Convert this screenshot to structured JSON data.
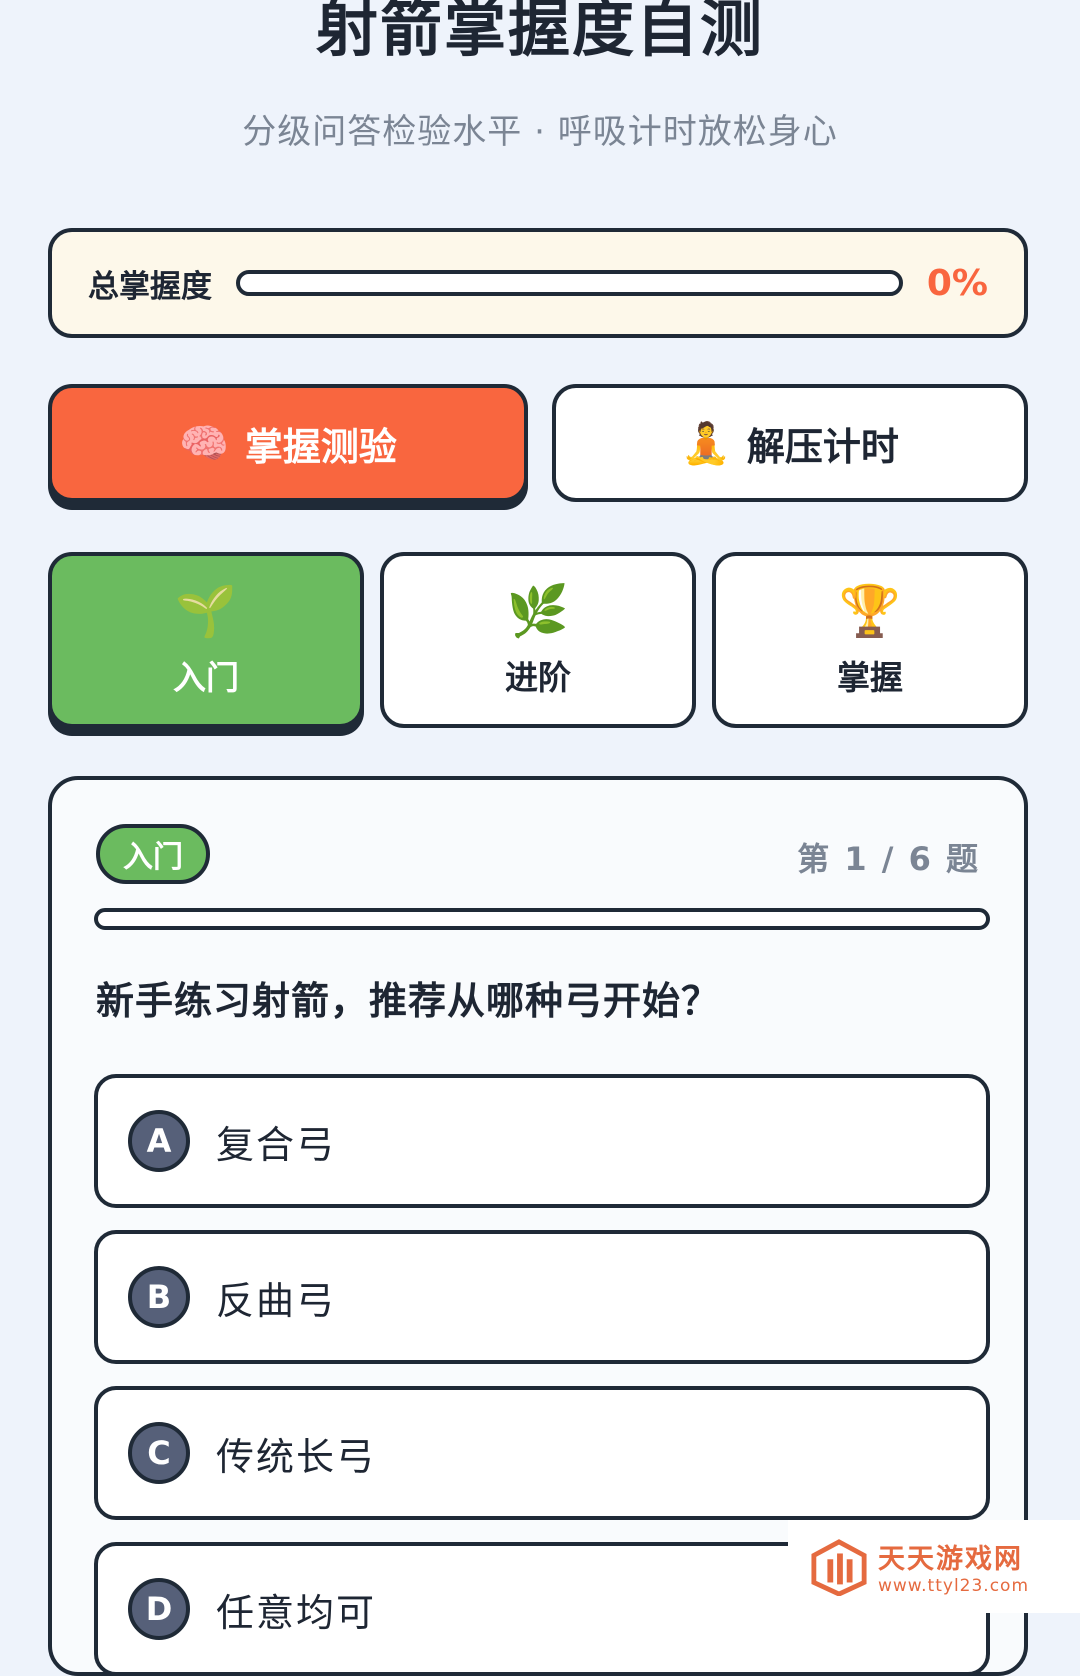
{
  "header": {
    "title": "射箭掌握度自测",
    "subtitle": "分级问答检验水平 · 呼吸计时放松身心"
  },
  "mastery": {
    "label": "总掌握度",
    "value_text": "0%",
    "progress_fraction": 0
  },
  "modes": [
    {
      "emoji": "🧠",
      "label": "掌握测验",
      "active": true
    },
    {
      "emoji": "🧘",
      "label": "解压计时",
      "active": false
    }
  ],
  "levels": [
    {
      "emoji": "🌱",
      "label": "入门",
      "active": true
    },
    {
      "emoji": "🌿",
      "label": "进阶",
      "active": false
    },
    {
      "emoji": "🏆",
      "label": "掌握",
      "active": false
    }
  ],
  "quiz": {
    "badge": "入门",
    "counter": "第 1 / 6 题",
    "progress_fraction": 0,
    "question": "新手练习射箭，推荐从哪种弓开始？",
    "options": [
      {
        "letter": "A",
        "text": "复合弓"
      },
      {
        "letter": "B",
        "text": "反曲弓"
      },
      {
        "letter": "C",
        "text": "传统长弓"
      },
      {
        "letter": "D",
        "text": "任意均可"
      }
    ]
  },
  "watermark": {
    "name": "天天游戏网",
    "url": "www.ttyl23.com"
  },
  "colors": {
    "accent_orange": "#f9663f",
    "accent_green": "#6bbb5f",
    "outline": "#1f2a37",
    "background": "#eef3fb"
  }
}
